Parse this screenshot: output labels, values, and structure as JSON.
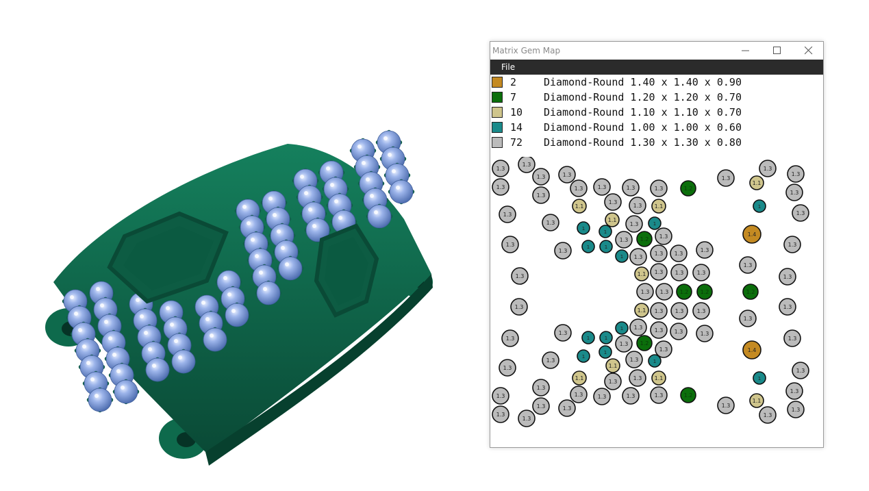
{
  "window": {
    "title": "Matrix Gem Map",
    "menu": [
      "File"
    ]
  },
  "legend": [
    {
      "count": "2",
      "description": "Diamond-Round 1.40 x 1.40 x 0.90",
      "color": "#c48a22"
    },
    {
      "count": "7",
      "description": "Diamond-Round 1.20 x 1.20 x 0.70",
      "color": "#0b6e0b"
    },
    {
      "count": "10",
      "description": "Diamond-Round 1.10 x 1.10 x 0.70",
      "color": "#cfc58c"
    },
    {
      "count": "14",
      "description": "Diamond-Round 1.00 x 1.00 x 0.60",
      "color": "#1a8a8a"
    },
    {
      "count": "72",
      "description": "Diamond-Round 1.30 x 1.30 x 0.80",
      "color": "#bbbbbb"
    }
  ],
  "gem_labels": {
    "d140": "1.4",
    "d130": "1.3",
    "d120": "1.2",
    "d110": "1.1",
    "d100": "1"
  },
  "colors": {
    "metal": "#0e5e45",
    "gem": "#8aa6e0",
    "menubar": "#2b2b2b"
  }
}
